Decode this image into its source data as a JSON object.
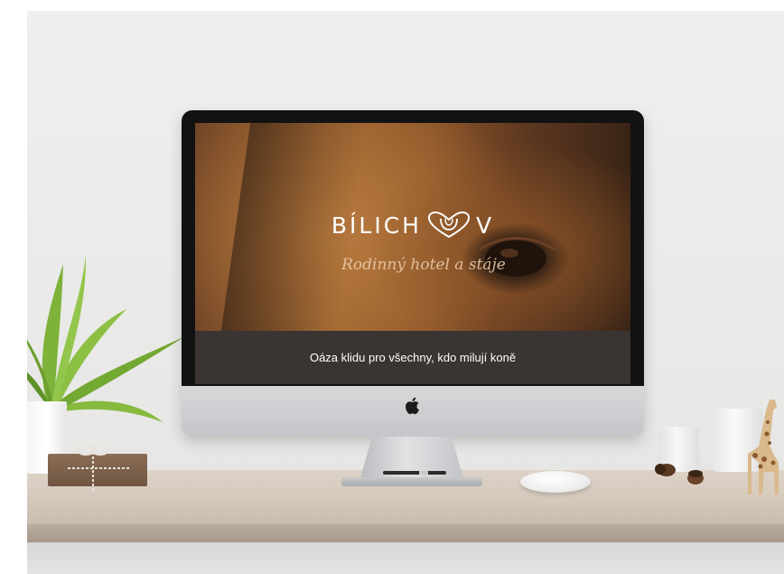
{
  "website": {
    "logo_text_left": "BÍLICH",
    "logo_text_right": "V",
    "logo_script": "Rodinný hotel a stáje",
    "caption": "Oáza klidu pro všechny, kdo milují koně"
  },
  "icons": {
    "logo": "horseshoe-heart-icon",
    "computer_brand": "apple-icon"
  },
  "colors": {
    "bezel": "#121212",
    "caption_band": "#3a3432",
    "caption_text": "#ffffff",
    "hero_brown": "#9c6330"
  }
}
